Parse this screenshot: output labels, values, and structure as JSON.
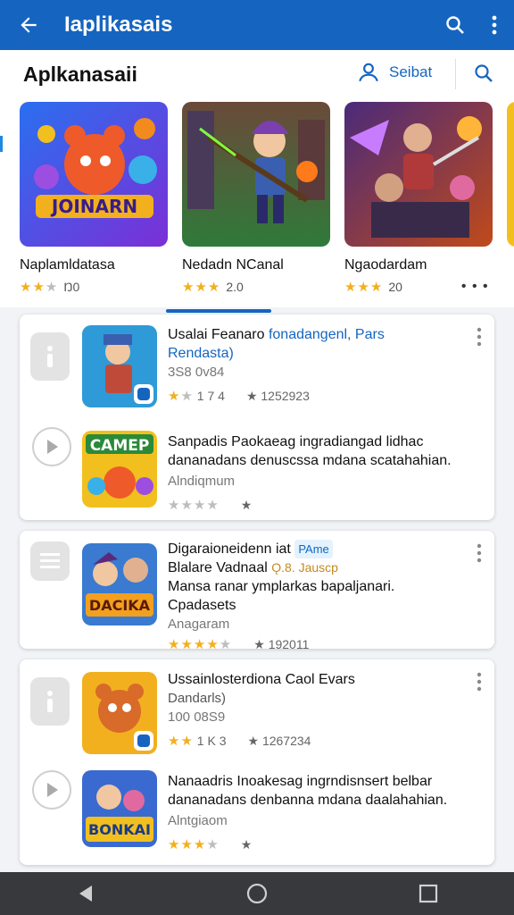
{
  "appbar": {
    "title": "Iaplikasais",
    "back_icon": "arrow-left-icon",
    "search_icon": "search-icon",
    "more_icon": "more-vertical-icon",
    "color": "#1565c0"
  },
  "section": {
    "title": "Aplkanasaii",
    "people_label": "Seibat"
  },
  "featured": [
    {
      "name": "Naplamldatasa",
      "rating_text": "Ŋ0",
      "stars": 2.5
    },
    {
      "name": "Nedadn NCanal",
      "rating_text": "2.0",
      "stars": 3
    },
    {
      "name": "Ngaodardam",
      "rating_text": "20",
      "stars": 3
    }
  ],
  "list": [
    {
      "rows": [
        {
          "title": "Usalai Feanaro",
          "title_accent": "fonadangenl, Pars",
          "subtitle": "Rendasta)",
          "line3": "3S8 0v84",
          "rating_text": "1 7 4",
          "reviews": "★ 1252923"
        },
        {
          "title": "Sanpadis Paokaeag ingradiangad lidhac dananadans denuscssa mdana scatahahian.",
          "dev": "Alndiqmum",
          "rating_text": "",
          "reviews": "★"
        }
      ]
    },
    {
      "rows": [
        {
          "title": "Digaraioneidenn iat",
          "pill": "PAme",
          "title2": "Blalare Vadnaal",
          "extra": "Ǫ.8. Jauscp",
          "desc": "Mansa ranar ymplarkas bapaljanari. Cpadasets",
          "dev": "Anagaram",
          "reviews": "★ 192011"
        }
      ]
    },
    {
      "rows": [
        {
          "title": "Ussainlosterdiona Caol Evars",
          "subtitle": "Dandarls)",
          "line3": "100 08S9",
          "rating_text": "1 K 3",
          "reviews": "★ 1267234"
        },
        {
          "title": "Nanaadris Inoakesag ingrndisnsert belbar dananadans denbanna mdana daalahahian.",
          "dev": "Alntgiaom",
          "reviews": "★"
        }
      ]
    }
  ],
  "navbar": {
    "back": "triangle-back-icon",
    "home": "circle-home-icon",
    "recents": "square-recents-icon"
  }
}
